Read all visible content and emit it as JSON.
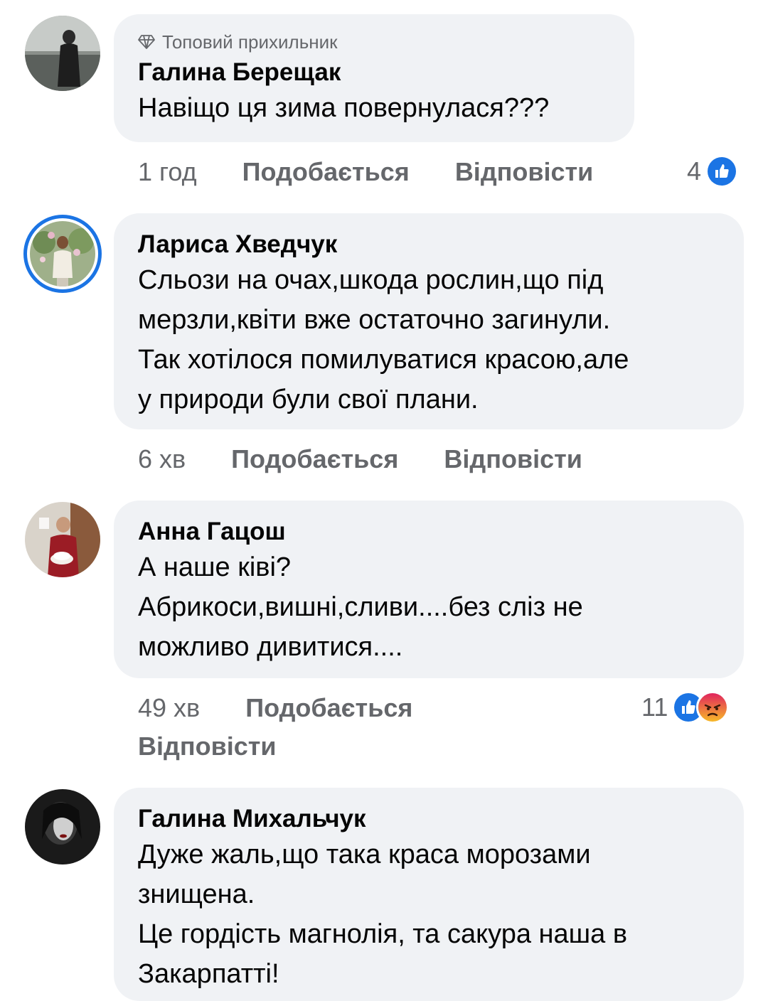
{
  "comments": [
    {
      "badge": "Топовий прихильник",
      "author": "Галина Берещак",
      "text": "Навіщо ця зима повернулася???",
      "time": "1 год",
      "like_label": "Подобається",
      "reply_label": "Відповісти",
      "reaction_count": "4",
      "reactions": [
        "like-icon"
      ]
    },
    {
      "author": "Лариса Хведчук",
      "text": "Сльози на очах,шкода рослин,що під\nмерзли,квіти вже остаточно загинули.\nТак хотілося помилуватися красою,але\nу природи були свої плани.",
      "time": "6 хв",
      "like_label": "Подобається",
      "reply_label": "Відповісти"
    },
    {
      "author": "Анна Гацош",
      "text": "А наше ківі?\nАбрикоси,вишні,сливи....без сліз не\nможливо дивитися....",
      "time": "49 хв",
      "like_label": "Подобається",
      "reply_label": "Відповісти",
      "reaction_count": "11",
      "reactions": [
        "like-icon",
        "angry-icon"
      ]
    },
    {
      "author": "Галина Михальчук",
      "text": "Дуже жаль,що така краса морозами\nзнищена.\nЦе гордість магнолія, та сакура наша в\nЗакарпатті!"
    }
  ],
  "colors": {
    "bubble": "#f0f2f5",
    "secondary_text": "#65676b",
    "like_blue": "#1b74e4",
    "angry_orange": "#f2661f"
  }
}
